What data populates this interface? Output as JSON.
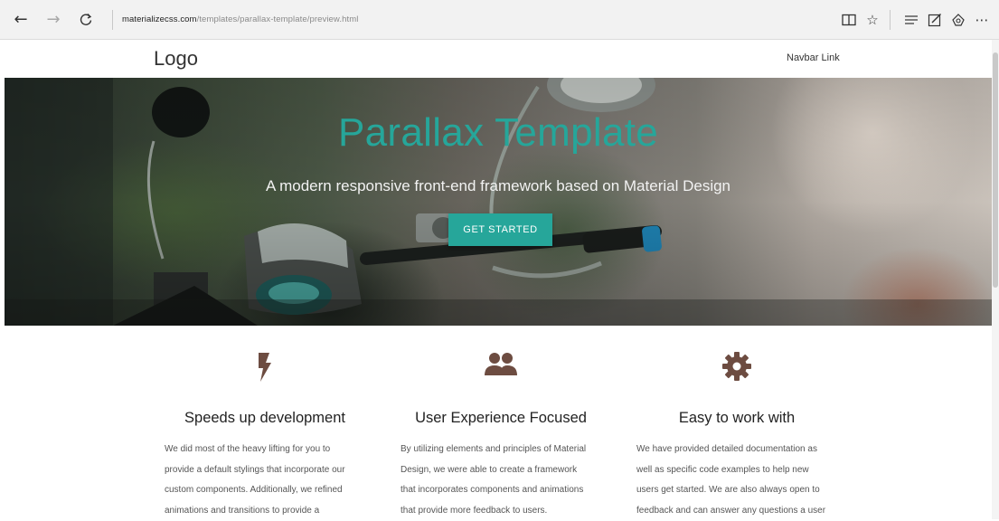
{
  "browser": {
    "url_host": "materializecss.com",
    "url_path": "/templates/parallax-template/preview.html",
    "icons": [
      "back-arrow-icon",
      "forward-arrow-icon",
      "refresh-icon",
      "reading-view-icon",
      "favorite-star-icon",
      "hub-icon",
      "web-note-icon",
      "share-icon",
      "more-icon"
    ]
  },
  "navbar": {
    "logo": "Logo",
    "link": "Navbar Link"
  },
  "hero": {
    "title": "Parallax Template",
    "subtitle": "A modern responsive front-end framework based on Material Design",
    "button": "GET STARTED"
  },
  "features": [
    {
      "icon": "flash-icon",
      "title": "Speeds up development",
      "lines": [
        "We did most of the heavy lifting for you to",
        "provide a default stylings that incorporate our",
        "custom components. Additionally, we refined",
        "animations and transitions to provide a"
      ]
    },
    {
      "icon": "group-icon",
      "title": "User Experience Focused",
      "lines": [
        "By utilizing elements and principles of Material",
        "Design, we were able to create a framework",
        "that incorporates components and animations",
        "that provide more feedback to users."
      ]
    },
    {
      "icon": "settings-icon",
      "title": "Easy to work with",
      "lines": [
        "We have provided detailed documentation as",
        "well as specific code examples to help new",
        "users get started. We are also always open to",
        "feedback and can answer any questions a user"
      ]
    }
  ],
  "colors": {
    "accent": "#26a69a",
    "icon_brown": "#6d4c41"
  }
}
